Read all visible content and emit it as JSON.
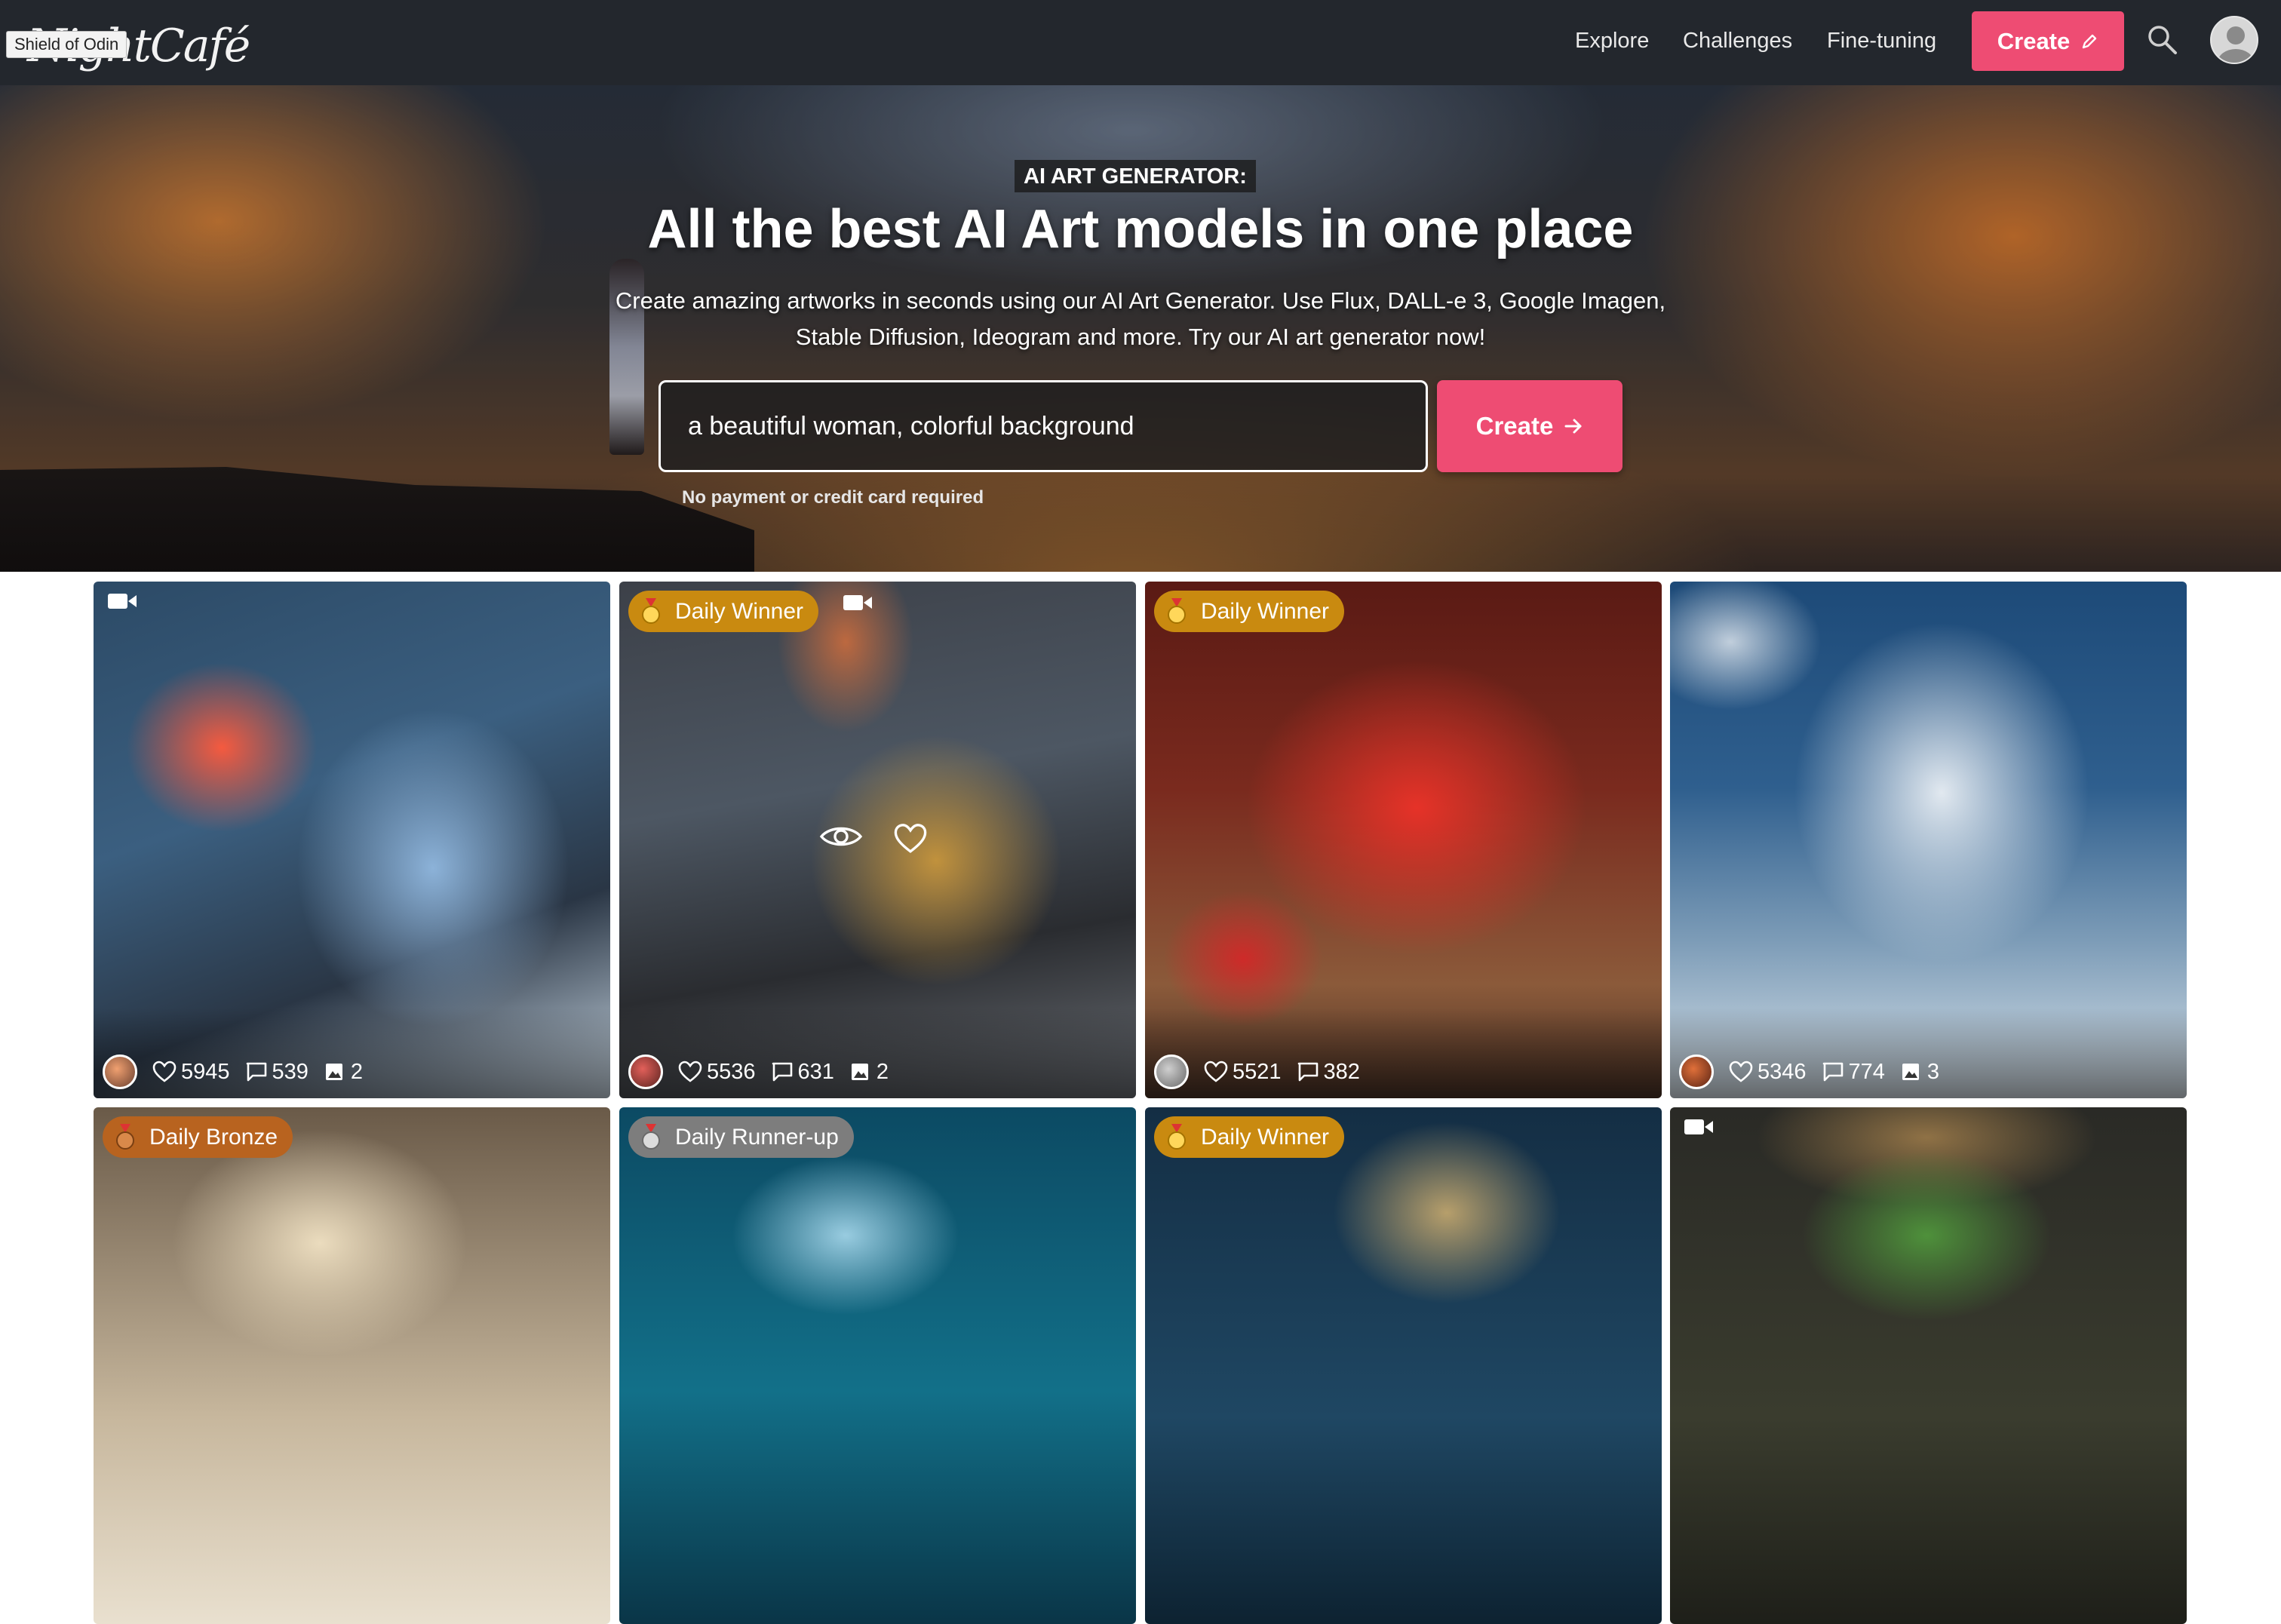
{
  "header": {
    "logo_text": "NightCafé",
    "logo_tooltip": "Shield of Odin",
    "nav": [
      "Explore",
      "Challenges",
      "Fine-tuning"
    ],
    "create_label": "Create",
    "icons": [
      "pencil-icon",
      "search-icon",
      "user-avatar"
    ]
  },
  "hero": {
    "tag": "AI ART GENERATOR:",
    "title": "All the best AI Art models in one place",
    "subtitle": "Create amazing artworks in seconds using our AI Art Generator. Use Flux, DALL-e 3, Google Imagen, Stable Diffusion, Ideogram and more. Try our AI art generator now!",
    "prompt_value": "a beautiful woman, colorful background",
    "create_label": "Create",
    "note": "No payment or credit card required"
  },
  "cards": [
    {
      "badge": "",
      "video": true,
      "likes": "5945",
      "comments": "539",
      "images": "2",
      "palette": "mouse"
    },
    {
      "badge": "Daily Winner",
      "medal": "gold",
      "video": true,
      "likes": "5536",
      "comments": "631",
      "images": "2",
      "palette": "warrior"
    },
    {
      "badge": "Daily Winner",
      "medal": "gold",
      "video": false,
      "likes": "5521",
      "comments": "382",
      "images": "",
      "palette": "strawberry-cat"
    },
    {
      "badge": "",
      "video": false,
      "likes": "5346",
      "comments": "774",
      "images": "3",
      "palette": "castle"
    },
    {
      "badge": "Daily Bronze",
      "medal": "bronze",
      "video": false,
      "palette": "dog"
    },
    {
      "badge": "Daily Runner-up",
      "medal": "silver",
      "video": false,
      "palette": "shell"
    },
    {
      "badge": "Daily Winner",
      "medal": "gold",
      "video": false,
      "palette": "butterfly"
    },
    {
      "badge": "",
      "video": true,
      "palette": "leaf"
    }
  ],
  "colors": {
    "accent": "#ee4c73",
    "navbar": "#23272d",
    "gold_badge": "#c98a10",
    "bronze_badge": "#b8631f",
    "silver_badge": "#7d7d7d"
  }
}
